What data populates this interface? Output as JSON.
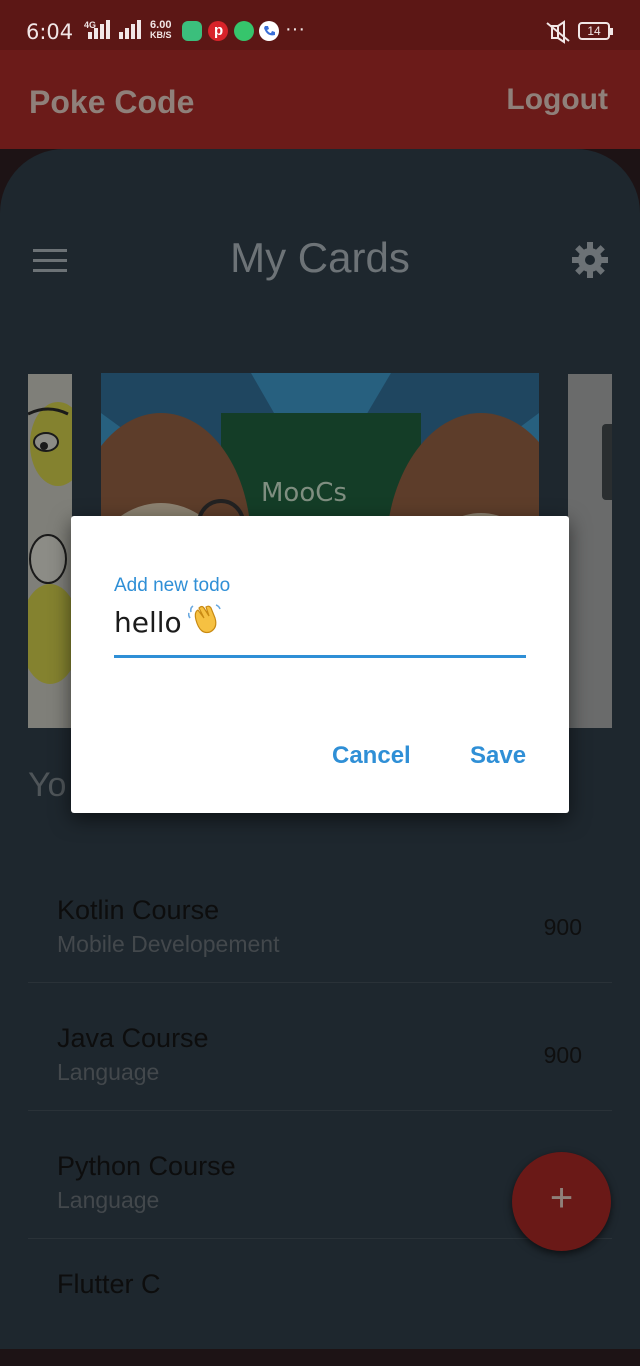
{
  "status_bar": {
    "time": "6:04",
    "network": "4G",
    "speed_value": "6.00",
    "speed_unit": "KB/S",
    "more": "···",
    "battery": "14",
    "icons": [
      "signal-icon",
      "app-icon",
      "pinterest-icon",
      "whatsapp-icon",
      "phone-icon",
      "mute-icon",
      "battery-icon"
    ]
  },
  "app_bar": {
    "title": "Poke Code",
    "logout_label": "Logout",
    "color": "#6b1b19"
  },
  "page": {
    "title": "My Cards",
    "menu_icon": "menu-icon",
    "settings_icon": "gear-icon"
  },
  "carousel": {
    "center_card_text": "MooCs"
  },
  "section": {
    "heading": "Yo"
  },
  "courses": [
    {
      "title": "Kotlin Course",
      "subtitle": "Mobile Developement",
      "value": "900"
    },
    {
      "title": "Java Course",
      "subtitle": "Language",
      "value": "900"
    },
    {
      "title": "Python Course",
      "subtitle": "Language",
      "value": ""
    },
    {
      "title": "Flutter C",
      "subtitle": "",
      "value": ""
    }
  ],
  "dialog": {
    "field_label": "Add new todo",
    "field_value": "hello",
    "emoji": "👋",
    "cancel_label": "Cancel",
    "save_label": "Save",
    "accent": "#2f8fd6"
  },
  "fab": {
    "label": "+"
  }
}
